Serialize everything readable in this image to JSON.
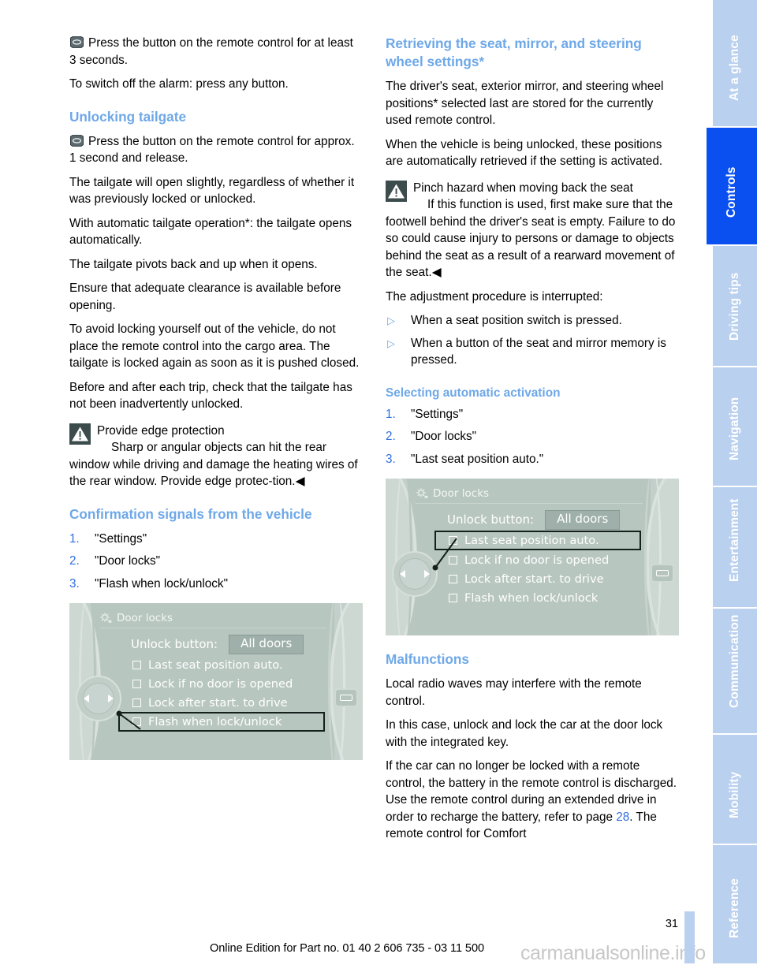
{
  "document": {
    "page_number": "31",
    "footer_note": "Online Edition for Part no. 01 40 2 606 735 - 03 11 500",
    "watermark": "carmanualsonline.info"
  },
  "colors": {
    "heading_blue": "#6ea8e8",
    "accent_blue": "#2f6fe0",
    "tab_active": "#0a50f0",
    "tab_inactive": "#b9d0ef",
    "warning_box": "#3c4c4c",
    "idrive_bg": "#b8c6c0"
  },
  "tab_rail": {
    "tabs": [
      {
        "label": "At a glance",
        "active": false
      },
      {
        "label": "Controls",
        "active": true
      },
      {
        "label": "Driving tips",
        "active": false
      },
      {
        "label": "Navigation",
        "active": false
      },
      {
        "label": "Entertainment",
        "active": false
      },
      {
        "label": "Communication",
        "active": false
      },
      {
        "label": "Mobility",
        "active": false
      },
      {
        "label": "Reference",
        "active": false
      }
    ]
  },
  "left_column": {
    "p_alarm_press": "Press the button on the remote control for at least 3 seconds.",
    "p_switch_off": "To switch off the alarm: press any button.",
    "h_unlocking_tailgate": "Unlocking tailgate",
    "p_press_approx": "Press the button on the remote control for approx. 1 second and release.",
    "p_open_slightly": "The tailgate will open slightly, regardless of whether it was previously locked or unlocked.",
    "p_auto_operation": "With automatic tailgate operation*: the tailgate opens automatically.",
    "p_pivots": "The tailgate pivots back and up when it opens.",
    "p_clearance": "Ensure that adequate clearance is available before opening.",
    "p_avoid_locking": "To avoid locking yourself out of the vehicle, do not place the remote control into the cargo area. The tailgate is locked again as soon as it is pushed closed.",
    "p_before_after": "Before and after each trip, check that the tailgate has not been inadvertently unlocked.",
    "warning": {
      "heading": "Provide edge protection",
      "body": "Sharp or angular objects can hit the rear window while driving and damage the heating wires of the rear window. Provide edge protec-tion.",
      "endmark": "◀"
    },
    "h_confirmation": "Confirmation signals from the vehicle",
    "steps": [
      {
        "num": "1.",
        "label": "\"Settings\""
      },
      {
        "num": "2.",
        "label": "\"Door locks\""
      },
      {
        "num": "3.",
        "label": "\"Flash when lock/unlock\""
      }
    ],
    "idrive": {
      "title": "Door locks",
      "unlock_label": "Unlock button:",
      "unlock_value": "All doors",
      "options": [
        {
          "label": "Last seat position auto.",
          "checked": false,
          "highlighted": false
        },
        {
          "label": "Lock if no door is opened",
          "checked": false,
          "highlighted": false
        },
        {
          "label": "Lock after start. to drive",
          "checked": false,
          "highlighted": false
        },
        {
          "label": "Flash when lock/unlock",
          "checked": false,
          "highlighted": true
        }
      ]
    }
  },
  "right_column": {
    "h_retrieving": "Retrieving the seat, mirror, and steering wheel settings*",
    "p_drivers_seat": "The driver's seat, exterior mirror, and steering wheel positions* selected last are stored for the currently used remote control.",
    "p_being_unlocked": "When the vehicle is being unlocked, these positions are automatically retrieved if the setting is activated.",
    "warning": {
      "heading": "Pinch hazard when moving back the seat",
      "body": "If this function is used, first make sure that the footwell behind the driver's seat is empty. Failure to do so could cause injury to persons or damage to objects behind the seat as a result of a rearward movement of the seat.",
      "endmark": "◀"
    },
    "p_interrupted": "The adjustment procedure is interrupted:",
    "bullets": [
      "When a seat position switch is pressed.",
      "When a button of the seat and mirror memory is pressed."
    ],
    "h_selecting": "Selecting automatic activation",
    "steps": [
      {
        "num": "1.",
        "label": "\"Settings\""
      },
      {
        "num": "2.",
        "label": "\"Door locks\""
      },
      {
        "num": "3.",
        "label": "\"Last seat position auto.\""
      }
    ],
    "idrive": {
      "title": "Door locks",
      "unlock_label": "Unlock button:",
      "unlock_value": "All doors",
      "options": [
        {
          "label": "Last seat position auto.",
          "checked": false,
          "highlighted": true
        },
        {
          "label": "Lock if no door is opened",
          "checked": false,
          "highlighted": false
        },
        {
          "label": "Lock after start. to drive",
          "checked": false,
          "highlighted": false
        },
        {
          "label": "Flash when lock/unlock",
          "checked": false,
          "highlighted": false
        }
      ]
    },
    "h_malfunctions": "Malfunctions",
    "p_radio_waves": "Local radio waves may interfere with the remote control.",
    "p_in_this_case": "In this case, unlock and lock the car at the door lock with the integrated key.",
    "p_battery_pre": "If the car can no longer be locked with a remote control, the battery in the remote control is discharged. Use the remote control during an extended drive in order to recharge the battery, refer to page ",
    "p_battery_ref": "28",
    "p_battery_post": ". The remote control for Comfort"
  }
}
